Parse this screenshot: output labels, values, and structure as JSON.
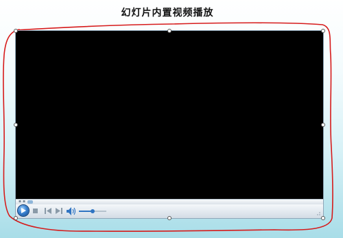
{
  "slide": {
    "title": "幻灯片内置视频播放"
  },
  "player": {
    "volume_level": 0.5,
    "seek_position": 0.0,
    "accent_color": "#2f74c2",
    "screen_color": "#000000",
    "icons": [
      "play-icon",
      "stop-icon",
      "previous-icon",
      "next-icon",
      "volume-icon"
    ]
  },
  "annotation": {
    "color": "#d61a1a"
  }
}
